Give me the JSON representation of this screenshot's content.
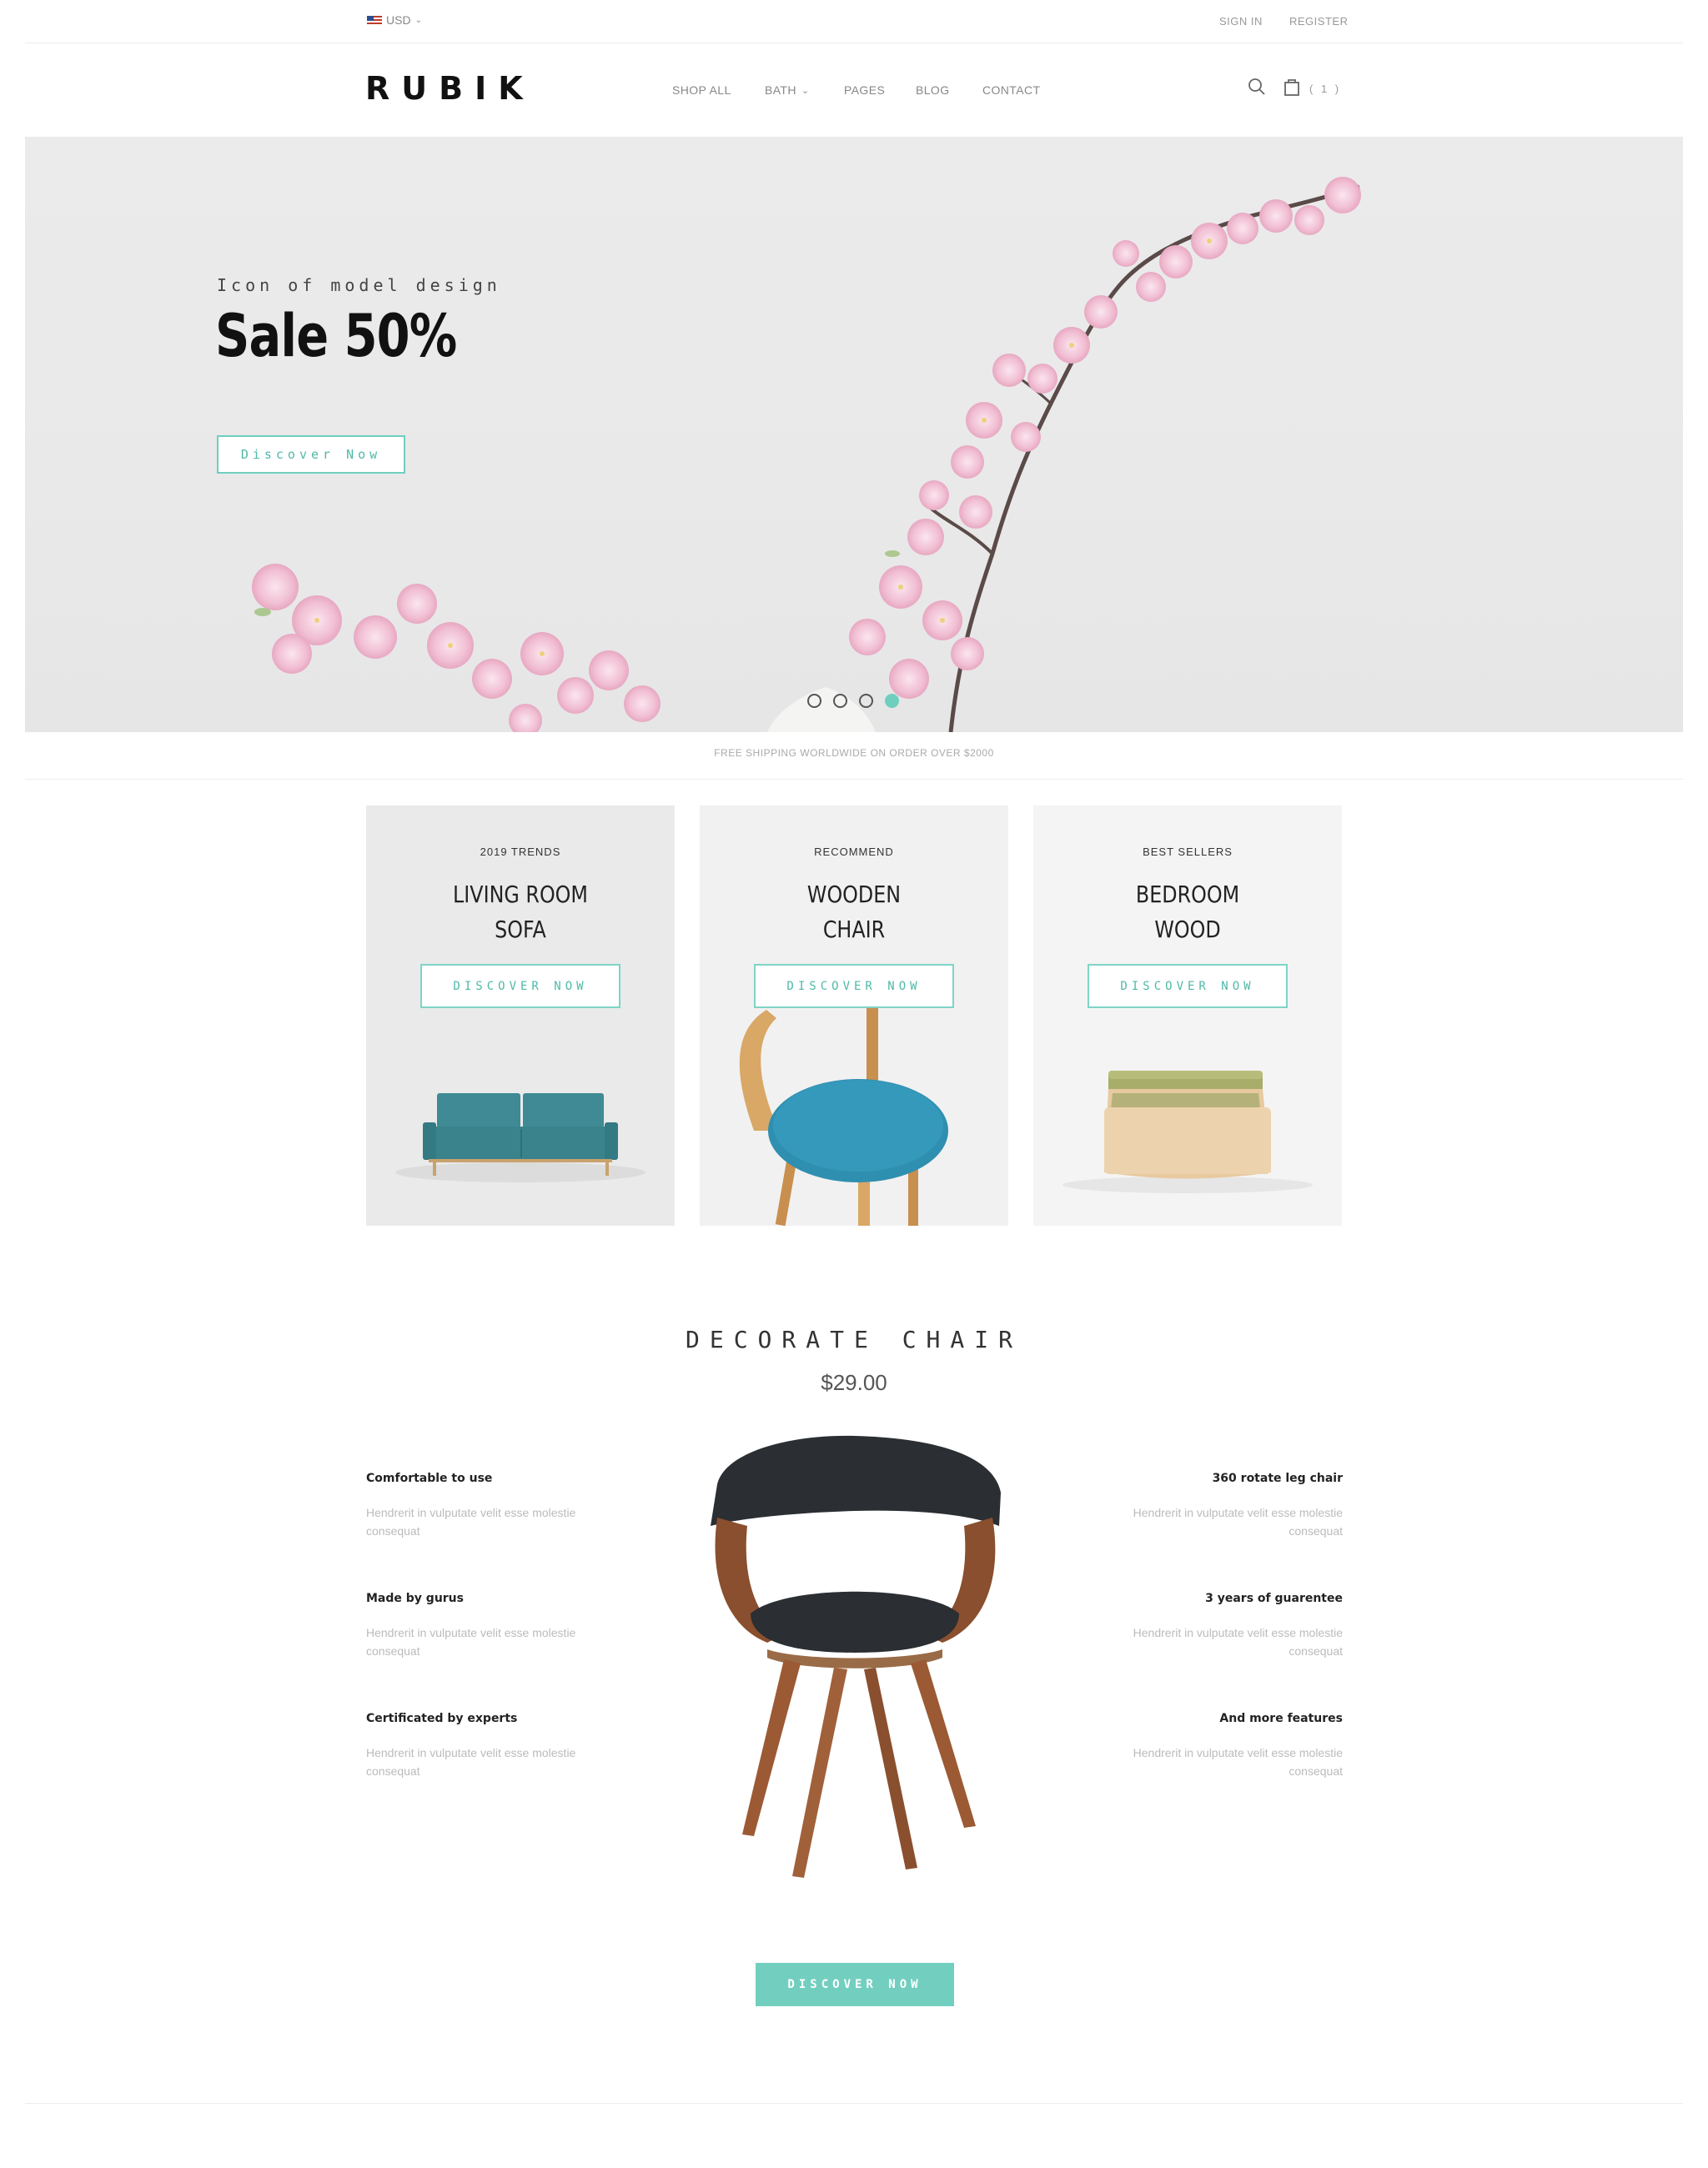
{
  "topbar": {
    "currency": "USD",
    "sign_in": "SIGN IN",
    "register": "REGISTER"
  },
  "header": {
    "logo": "RUBIK",
    "nav": [
      "SHOP ALL",
      "BATH",
      "PAGES",
      "BLOG",
      "CONTACT"
    ],
    "cart_count": "( 1 )"
  },
  "hero": {
    "kicker": "Icon of model design",
    "title": "Sale 50%",
    "button": "Discover Now",
    "slide_count": 4,
    "active_slide": 4
  },
  "shipping_note": "FREE SHIPPING WORLDWIDE ON ORDER OVER $2000",
  "cards": [
    {
      "kicker": "2019 TRENDS",
      "title_line1": "LIVING ROOM",
      "title_line2": "SOFA",
      "button": "DISCOVER NOW"
    },
    {
      "kicker": "RECOMMEND",
      "title_line1": "WOODEN",
      "title_line2": "CHAIR",
      "button": "DISCOVER NOW"
    },
    {
      "kicker": "BEST SELLERS",
      "title_line1": "BEDROOM",
      "title_line2": "WOOD",
      "button": "DISCOVER NOW"
    }
  ],
  "featured": {
    "title": "DECORATE CHAIR",
    "price": "$29.00",
    "features_left": [
      {
        "title": "Comfortable to use",
        "desc": "Hendrerit in vulputate velit esse molestie consequat"
      },
      {
        "title": "Made by gurus",
        "desc": "Hendrerit in vulputate velit esse molestie consequat"
      },
      {
        "title": "Certificated by experts",
        "desc": "Hendrerit in vulputate velit esse molestie consequat"
      }
    ],
    "features_right": [
      {
        "title": "360 rotate leg chair",
        "desc": "Hendrerit in vulputate velit esse molestie consequat"
      },
      {
        "title": "3 years of guarentee",
        "desc": "Hendrerit in vulputate velit esse molestie consequat"
      },
      {
        "title": "And more features",
        "desc": "Hendrerit in vulputate velit esse molestie consequat"
      }
    ],
    "cta": "DISCOVER NOW"
  },
  "colors": {
    "accent": "#72cfbf",
    "text_dark": "#222222",
    "text_muted": "#999999"
  }
}
